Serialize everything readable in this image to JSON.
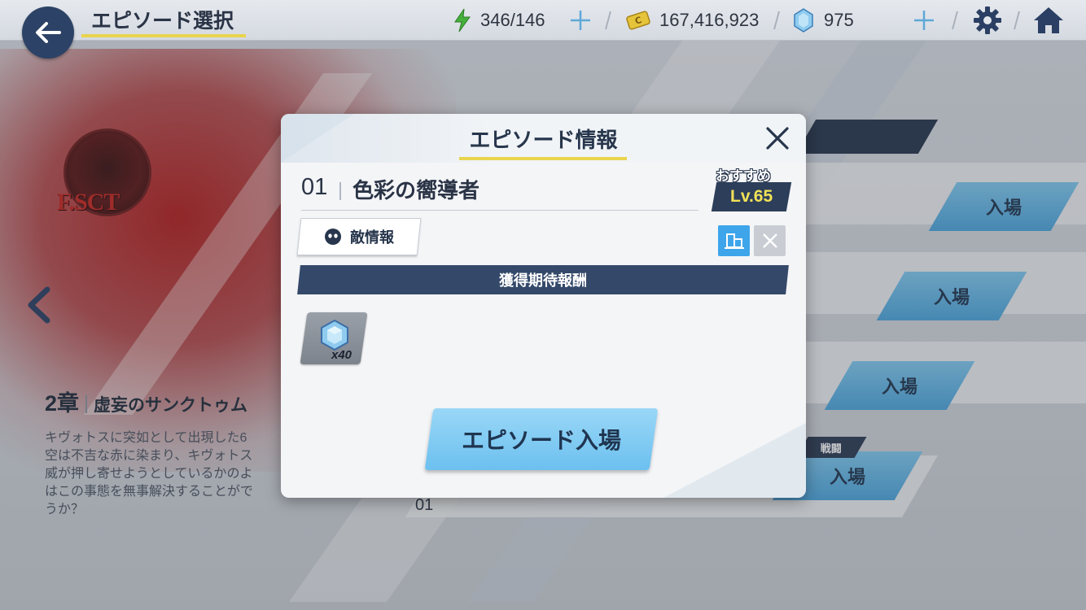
{
  "topbar": {
    "title": "エピソード選択",
    "ap": "346/146",
    "credits": "167,416,923",
    "gems": "975"
  },
  "chapter": {
    "number": "2章",
    "name": "虚妄のサンクトゥム",
    "description": "キヴォトスに突如として出現した6\n空は不吉な赤に染まり、キヴォトス\n威が押し寄せようとしているかのよ\nはこの事態を無事解決することがで\nうか？"
  },
  "logo": {
    "text": "F.SCT"
  },
  "episode_list": {
    "enter_label": "入場",
    "battle_tag": "戦闘",
    "row_number": "01"
  },
  "modal": {
    "title": "エピソード情報",
    "episode_number": "01",
    "episode_name": "色彩の嚮導者",
    "recommended_label": "おすすめ",
    "recommended_level": "Lv.65",
    "enemy_info_label": "敵情報",
    "reward_header": "獲得期待報酬",
    "rewards": [
      {
        "icon": "gem-icon",
        "count": "x40"
      }
    ],
    "enter_button": "エピソード入場"
  },
  "colors": {
    "accent_yellow": "#e8d44d",
    "navy": "#2c4266",
    "button_blue": "#6cc0ef",
    "terrain_blue": "#3ea5ea"
  }
}
